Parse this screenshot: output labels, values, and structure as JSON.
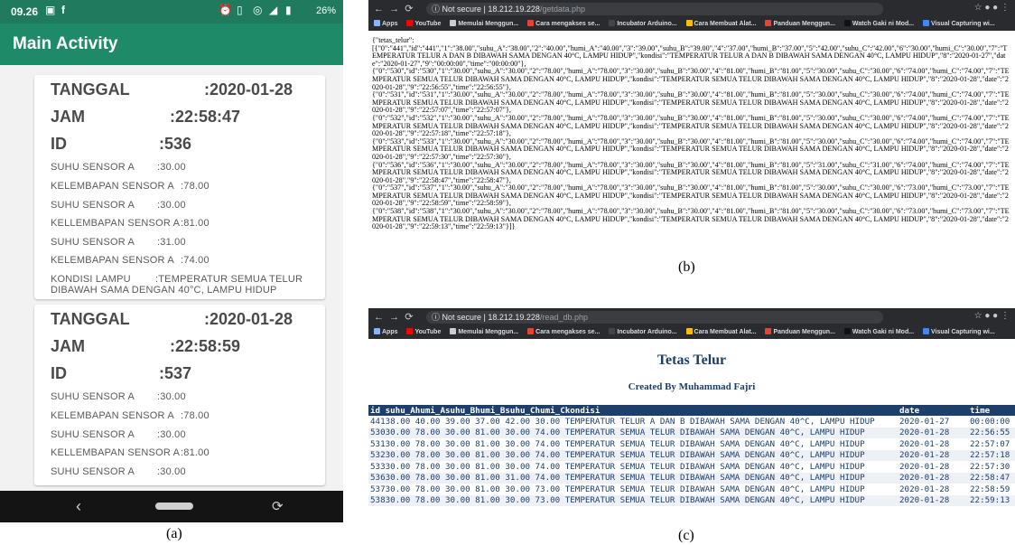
{
  "phone": {
    "status_time": "09.26",
    "status_right": "26%",
    "app_title": "Main Activity",
    "cards": [
      {
        "tanggal_label": "TANGGAL",
        "tanggal": ":2020-01-28",
        "jam_label": "JAM",
        "jam": ":22:58:47",
        "id_label": "ID",
        "id": ":536",
        "rows": [
          {
            "label": "SUHU SENSOR A",
            "value": ":30.00"
          },
          {
            "label": "KELEMBAPAN SENSOR A",
            "value": ":78.00"
          },
          {
            "label": "SUHU SENSOR A",
            "value": ":30.00"
          },
          {
            "label": "KELLEMBAPAN SENSOR A",
            "value": ":81.00"
          },
          {
            "label": "SUHU SENSOR A",
            "value": ":31.00"
          },
          {
            "label": "KELEMBAPAN SENSOR A",
            "value": ":74.00"
          }
        ],
        "kondisi_label": "KONDISI LAMPU",
        "kondisi_1": ":TEMPERATUR SEMUA TELUR",
        "kondisi_2": "DIBAWAH SAMA DENGAN 40°C, LAMPU HIDUP"
      },
      {
        "tanggal_label": "TANGGAL",
        "tanggal": ":2020-01-28",
        "jam_label": "JAM",
        "jam": ":22:58:59",
        "id_label": "ID",
        "id": ":537",
        "rows": [
          {
            "label": "SUHU SENSOR A",
            "value": ":30.00"
          },
          {
            "label": "KELEMBAPAN SENSOR A",
            "value": ":78.00"
          },
          {
            "label": "SUHU SENSOR A",
            "value": ":30.00"
          },
          {
            "label": "KELLEMBAPAN SENSOR A",
            "value": ":81.00"
          },
          {
            "label": "SUHU SENSOR A",
            "value": ":30.00"
          }
        ]
      }
    ]
  },
  "bookmarks": [
    "Apps",
    "YouTube",
    "Memulai Menggun...",
    "Cara mengakses se...",
    "Incubator Arduino...",
    "Cara Membuat Alat...",
    "Panduan Menggun...",
    "Watch Gaki ni Mod...",
    "Visual Capturing wi..."
  ],
  "browser_b": {
    "url_prefix": "Not secure | 18.212.19.228",
    "url_path": "/getdata.php",
    "json_text": "{\"tetas_telur\":\n[{\"0\":\"441\",\"id\":\"441\",\"1\":\"38.00\",\"suhu_A\":\"38.00\",\"2\":\"40.00\",\"humi_A\":\"40.00\",\"3\":\"39.00\",\"suhu_B\":\"39.00\",\"4\":\"37.00\",\"humi_B\":\"37.00\",\"5\":\"42.00\",\"suhu_C\":\"42.00\",\"6\":\"30.00\",\"humi_C\":\"30.00\",\"7\":\"TEMPERATUR TELUR A DAN B DIBAWAH SAMA DENGAN 40°C, LAMPU HIDUP\",\"kondisi\":\"TEMPERATUR TELUR A DAN B DIBAWAH SAMA DENGAN 40°C, LAMPU HIDUP\",\"8\":\"2020-01-27\",\"date\":\"2020-01-27\",\"9\":\"00:00:00\",\"time\":\"00:00:00\"},\n{\"0\":\"530\",\"id\":\"530\",\"1\":\"30.00\",\"suhu_A\":\"30.00\",\"2\":\"78.00\",\"humi_A\":\"78.00\",\"3\":\"30.00\",\"suhu_B\":\"30.00\",\"4\":\"81.00\",\"humi_B\":\"81.00\",\"5\":\"30.00\",\"suhu_C\":\"30.00\",\"6\":\"74.00\",\"humi_C\":\"74.00\",\"7\":\"TEMPERATUR SEMUA TELUR DIBAWAH SAMA DENGAN 40°C, LAMPU HIDUP\",\"kondisi\":\"TEMPERATUR SEMUA TELUR DIBAWAH SAMA DENGAN 40°C, LAMPU HIDUP\",\"8\":\"2020-01-28\",\"date\":\"2020-01-28\",\"9\":\"22:56:55\",\"time\":\"22:56:55\"},\n{\"0\":\"531\",\"id\":\"531\",\"1\":\"30.00\",\"suhu_A\":\"30.00\",\"2\":\"78.00\",\"humi_A\":\"78.00\",\"3\":\"30.00\",\"suhu_B\":\"30.00\",\"4\":\"81.00\",\"humi_B\":\"81.00\",\"5\":\"30.00\",\"suhu_C\":\"30.00\",\"6\":\"74.00\",\"humi_C\":\"74.00\",\"7\":\"TEMPERATUR SEMUA TELUR DIBAWAH SAMA DENGAN 40°C, LAMPU HIDUP\",\"kondisi\":\"TEMPERATUR SEMUA TELUR DIBAWAH SAMA DENGAN 40°C, LAMPU HIDUP\",\"8\":\"2020-01-28\",\"date\":\"2020-01-28\",\"9\":\"22:57:07\",\"time\":\"22:57:07\"},\n{\"0\":\"532\",\"id\":\"532\",\"1\":\"30.00\",\"suhu_A\":\"30.00\",\"2\":\"78.00\",\"humi_A\":\"78.00\",\"3\":\"30.00\",\"suhu_B\":\"30.00\",\"4\":\"81.00\",\"humi_B\":\"81.00\",\"5\":\"30.00\",\"suhu_C\":\"30.00\",\"6\":\"74.00\",\"humi_C\":\"74.00\",\"7\":\"TEMPERATUR SEMUA TELUR DIBAWAH SAMA DENGAN 40°C, LAMPU HIDUP\",\"kondisi\":\"TEMPERATUR SEMUA TELUR DIBAWAH SAMA DENGAN 40°C, LAMPU HIDUP\",\"8\":\"2020-01-28\",\"date\":\"2020-01-28\",\"9\":\"22:57:18\",\"time\":\"22:57:18\"},\n{\"0\":\"533\",\"id\":\"533\",\"1\":\"30.00\",\"suhu_A\":\"30.00\",\"2\":\"78.00\",\"humi_A\":\"78.00\",\"3\":\"30.00\",\"suhu_B\":\"30.00\",\"4\":\"81.00\",\"humi_B\":\"81.00\",\"5\":\"30.00\",\"suhu_C\":\"30.00\",\"6\":\"74.00\",\"humi_C\":\"74.00\",\"7\":\"TEMPERATUR SEMUA TELUR DIBAWAH SAMA DENGAN 40°C, LAMPU HIDUP\",\"kondisi\":\"TEMPERATUR SEMUA TELUR DIBAWAH SAMA DENGAN 40°C, LAMPU HIDUP\",\"8\":\"2020-01-28\",\"date\":\"2020-01-28\",\"9\":\"22:57:30\",\"time\":\"22:57:30\"},\n{\"0\":\"536\",\"id\":\"536\",\"1\":\"30.00\",\"suhu_A\":\"30.00\",\"2\":\"78.00\",\"humi_A\":\"78.00\",\"3\":\"30.00\",\"suhu_B\":\"30.00\",\"4\":\"81.00\",\"humi_B\":\"81.00\",\"5\":\"31.00\",\"suhu_C\":\"31.00\",\"6\":\"74.00\",\"humi_C\":\"74.00\",\"7\":\"TEMPERATUR SEMUA TELUR DIBAWAH SAMA DENGAN 40°C, LAMPU HIDUP\",\"kondisi\":\"TEMPERATUR SEMUA TELUR DIBAWAH SAMA DENGAN 40°C, LAMPU HIDUP\",\"8\":\"2020-01-28\",\"date\":\"2020-01-28\",\"9\":\"22:58:47\",\"time\":\"22:58:47\"},\n{\"0\":\"537\",\"id\":\"537\",\"1\":\"30.00\",\"suhu_A\":\"30.00\",\"2\":\"78.00\",\"humi_A\":\"78.00\",\"3\":\"30.00\",\"suhu_B\":\"30.00\",\"4\":\"81.00\",\"humi_B\":\"81.00\",\"5\":\"30.00\",\"suhu_C\":\"30.00\",\"6\":\"73.00\",\"humi_C\":\"73.00\",\"7\":\"TEMPERATUR SEMUA TELUR DIBAWAH SAMA DENGAN 40°C, LAMPU HIDUP\",\"kondisi\":\"TEMPERATUR SEMUA TELUR DIBAWAH SAMA DENGAN 40°C, LAMPU HIDUP\",\"8\":\"2020-01-28\",\"date\":\"2020-01-28\",\"9\":\"22:58:59\",\"time\":\"22:58:59\"},\n{\"0\":\"538\",\"id\":\"538\",\"1\":\"30.00\",\"suhu_A\":\"30.00\",\"2\":\"78.00\",\"humi_A\":\"78.00\",\"3\":\"30.00\",\"suhu_B\":\"30.00\",\"4\":\"81.00\",\"humi_B\":\"81.00\",\"5\":\"30.00\",\"suhu_C\":\"30.00\",\"6\":\"73.00\",\"humi_C\":\"73.00\",\"7\":\"TEMPERATUR SEMUA TELUR DIBAWAH SAMA DENGAN 40°C, LAMPU HIDUP\",\"kondisi\":\"TEMPERATUR SEMUA TELUR DIBAWAH SAMA DENGAN 40°C, LAMPU HIDUP\",\"8\":\"2020-01-28\",\"date\":\"2020-01-28\",\"9\":\"22:59:13\",\"time\":\"22:59:13\"}]}"
  },
  "browser_c": {
    "url_prefix": "Not secure | 18.212.19.228",
    "url_path": "/read_db.php",
    "title": "Tetas Telur",
    "subtitle": "Created By Muhammad Fajri",
    "columns": [
      "id suhu_Ahumi_Asuhu_Bhumi_Bsuhu_Chumi_Ckondisi",
      "date",
      "time"
    ],
    "rows": [
      [
        "44138.00 40.00 39.00 37.00 42.00 30.00 TEMPERATUR TELUR A DAN B DIBAWAH SAMA DENGAN 40^C, LAMPU HIDUP",
        "2020-01-27",
        "00:00:00"
      ],
      [
        "53030.00 78.00 30.00 81.00 30.00 74.00 TEMPERATUR SEMUA TELUR DIBAWAH SAMA DENGAN 40^C, LAMPU HIDUP",
        "2020-01-28",
        "22:56:55"
      ],
      [
        "53130.00 78.00 30.00 81.00 30.00 74.00 TEMPERATUR SEMUA TELUR DIBAWAH SAMA DENGAN 40^C, LAMPU HIDUP",
        "2020-01-28",
        "22:57:07"
      ],
      [
        "53230.00 78.00 30.00 81.00 30.00 74.00 TEMPERATUR SEMUA TELUR DIBAWAH SAMA DENGAN 40^C, LAMPU HIDUP",
        "2020-01-28",
        "22:57:18"
      ],
      [
        "53330.00 78.00 30.00 81.00 30.00 74.00 TEMPERATUR SEMUA TELUR DIBAWAH SAMA DENGAN 40^C, LAMPU HIDUP",
        "2020-01-28",
        "22:57:30"
      ],
      [
        "53630.00 78.00 30.00 81.00 31.00 74.00 TEMPERATUR SEMUA TELUR DIBAWAH SAMA DENGAN 40^C, LAMPU HIDUP",
        "2020-01-28",
        "22:58:47"
      ],
      [
        "53730.00 78.00 30.00 81.00 30.00 73.00 TEMPERATUR SEMUA TELUR DIBAWAH SAMA DENGAN 40^C, LAMPU HIDUP",
        "2020-01-28",
        "22:58:59"
      ],
      [
        "53830.00 78.00 30.00 81.00 30.00 73.00 TEMPERATUR SEMUA TELUR DIBAWAH SAMA DENGAN 40^C, LAMPU HIDUP",
        "2020-01-28",
        "22:59:13"
      ]
    ]
  },
  "captions": {
    "a": "(a)",
    "b": "(b)",
    "c": "(c)"
  }
}
